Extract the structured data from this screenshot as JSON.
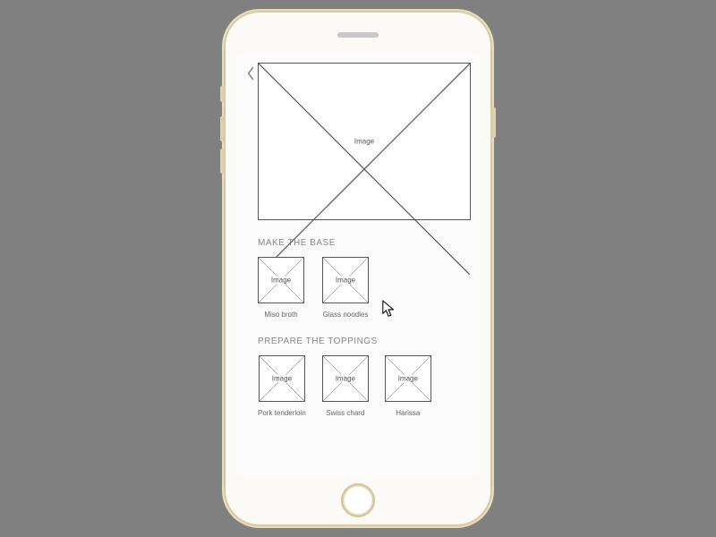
{
  "placeholder_label": "Image",
  "sections": [
    {
      "title": "MAKE THE BASE",
      "items": [
        {
          "caption": "Miso broth"
        },
        {
          "caption": "Glass noodles"
        }
      ]
    },
    {
      "title": "PREPARE THE TOPPINGS",
      "items": [
        {
          "caption": "Pork tenderloin"
        },
        {
          "caption": "Swiss chard"
        },
        {
          "caption": "Harissa"
        }
      ]
    }
  ]
}
